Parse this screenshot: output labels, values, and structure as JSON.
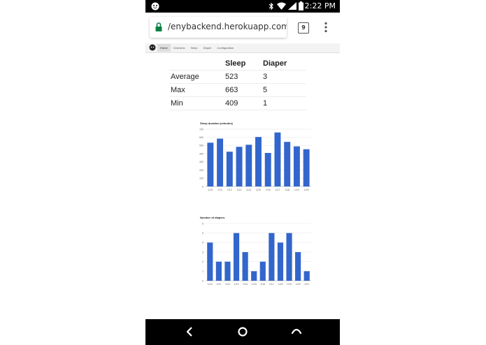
{
  "status_bar": {
    "time": "2:22 PM",
    "icons": [
      "android-face-icon",
      "bluetooth-icon",
      "wifi-icon",
      "signal-icon",
      "battery-icon"
    ]
  },
  "browser": {
    "url": "/enybackend.herokuapp.com/c",
    "tab_count": "9",
    "lock_color": "#0b8043"
  },
  "site_nav": {
    "items": [
      "Home",
      "Overview",
      "Sleep",
      "Diaper",
      "Configuration"
    ],
    "active": "Home"
  },
  "stats": {
    "headers": [
      "",
      "Sleep",
      "Diaper"
    ],
    "rows": [
      [
        "Average",
        "523",
        "3"
      ],
      [
        "Max",
        "663",
        "5"
      ],
      [
        "Min",
        "409",
        "1"
      ]
    ]
  },
  "chart_data": [
    {
      "type": "bar",
      "title": "Sleep duration (minutes)",
      "categories": [
        "1/10",
        "1/11",
        "1/12",
        "1/13",
        "1/14",
        "1/15",
        "1/16",
        "1/17",
        "1/18",
        "1/19",
        "1/20"
      ],
      "values": [
        535,
        585,
        425,
        485,
        510,
        605,
        410,
        660,
        545,
        490,
        455
      ],
      "ylim": [
        0,
        700
      ],
      "yticks": [
        0,
        100,
        200,
        300,
        400,
        500,
        600,
        700
      ],
      "grid": true,
      "color": "#3366cc"
    },
    {
      "type": "bar",
      "title": "Number of diapers",
      "categories": [
        "1/10",
        "1/11",
        "1/12",
        "1/13",
        "1/14",
        "1/15",
        "1/16",
        "1/17",
        "1/18",
        "1/19",
        "1/20",
        "1/21"
      ],
      "values": [
        4,
        2,
        2,
        5,
        3,
        1,
        2,
        5,
        4,
        5,
        3,
        1
      ],
      "ylim": [
        0,
        6
      ],
      "yticks": [
        0,
        1,
        2,
        3,
        4,
        5,
        6
      ],
      "grid": true,
      "color": "#3366cc"
    }
  ],
  "nav_bar": {
    "buttons": [
      "back",
      "home",
      "recents"
    ]
  }
}
